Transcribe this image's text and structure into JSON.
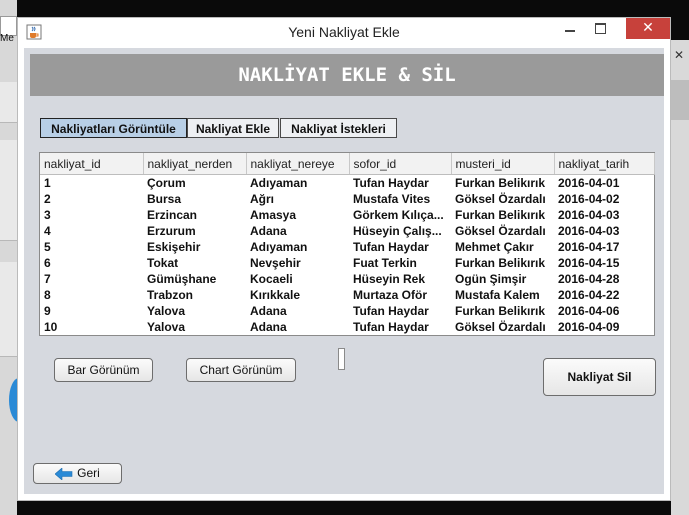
{
  "background": {
    "left_caption": "Me"
  },
  "window": {
    "title": "Yeni Nakliyat Ekle",
    "close_glyph": "✕"
  },
  "header": {
    "title": "NAKLİYAT EKLE & SİL"
  },
  "tabs": [
    {
      "label": "Nakliyatları Görüntüle",
      "active": true
    },
    {
      "label": "Nakliyat Ekle",
      "active": false
    },
    {
      "label": "Nakliyat İstekleri",
      "active": false
    }
  ],
  "table": {
    "columns": [
      "nakliyat_id",
      "nakliyat_nerden",
      "nakliyat_nereye",
      "sofor_id",
      "musteri_id",
      "nakliyat_tarih"
    ],
    "rows": [
      [
        "1",
        "Çorum",
        "Adıyaman",
        "Tufan Haydar",
        "Furkan Belikırık",
        "2016-04-01"
      ],
      [
        "2",
        "Bursa",
        "Ağrı",
        "Mustafa Vites",
        "Göksel Özardalı",
        "2016-04-02"
      ],
      [
        "3",
        "Erzincan",
        "Amasya",
        "Görkem Kılıça...",
        "Furkan Belikırık",
        "2016-04-03"
      ],
      [
        "4",
        "Erzurum",
        "Adana",
        "Hüseyin Çalış...",
        "Göksel Özardalı",
        "2016-04-03"
      ],
      [
        "5",
        "Eskişehir",
        "Adıyaman",
        "Tufan Haydar",
        "Mehmet Çakır",
        "2016-04-17"
      ],
      [
        "6",
        "Tokat",
        "Nevşehir",
        "Fuat Terkin",
        "Furkan Belikırık",
        "2016-04-15"
      ],
      [
        "7",
        "Gümüşhane",
        "Kocaeli",
        "Hüseyin Rek",
        "Ogün Şimşir",
        "2016-04-28"
      ],
      [
        "8",
        "Trabzon",
        "Kırıkkale",
        "Murtaza Oför",
        "Mustafa Kalem",
        "2016-04-22"
      ],
      [
        "9",
        "Yalova",
        "Adana",
        "Tufan Haydar",
        "Furkan Belikırık",
        "2016-04-06"
      ],
      [
        "10",
        "Yalova",
        "Adana",
        "Tufan Haydar",
        "Göksel Özardalı",
        "2016-04-09"
      ]
    ]
  },
  "buttons": {
    "bar": "Bar Görünüm",
    "chart": "Chart Görünüm",
    "delete": "Nakliyat Sil",
    "back": "Geri"
  },
  "colors": {
    "header_bg": "#9a9a9a",
    "content_bg": "#d6d9df",
    "active_tab": "#b8cfe6",
    "close_button": "#c7413b",
    "back_arrow": "#2a8ad6"
  },
  "icons": {
    "title": "java-coffee-cup-icon",
    "back": "left-arrow-icon"
  }
}
